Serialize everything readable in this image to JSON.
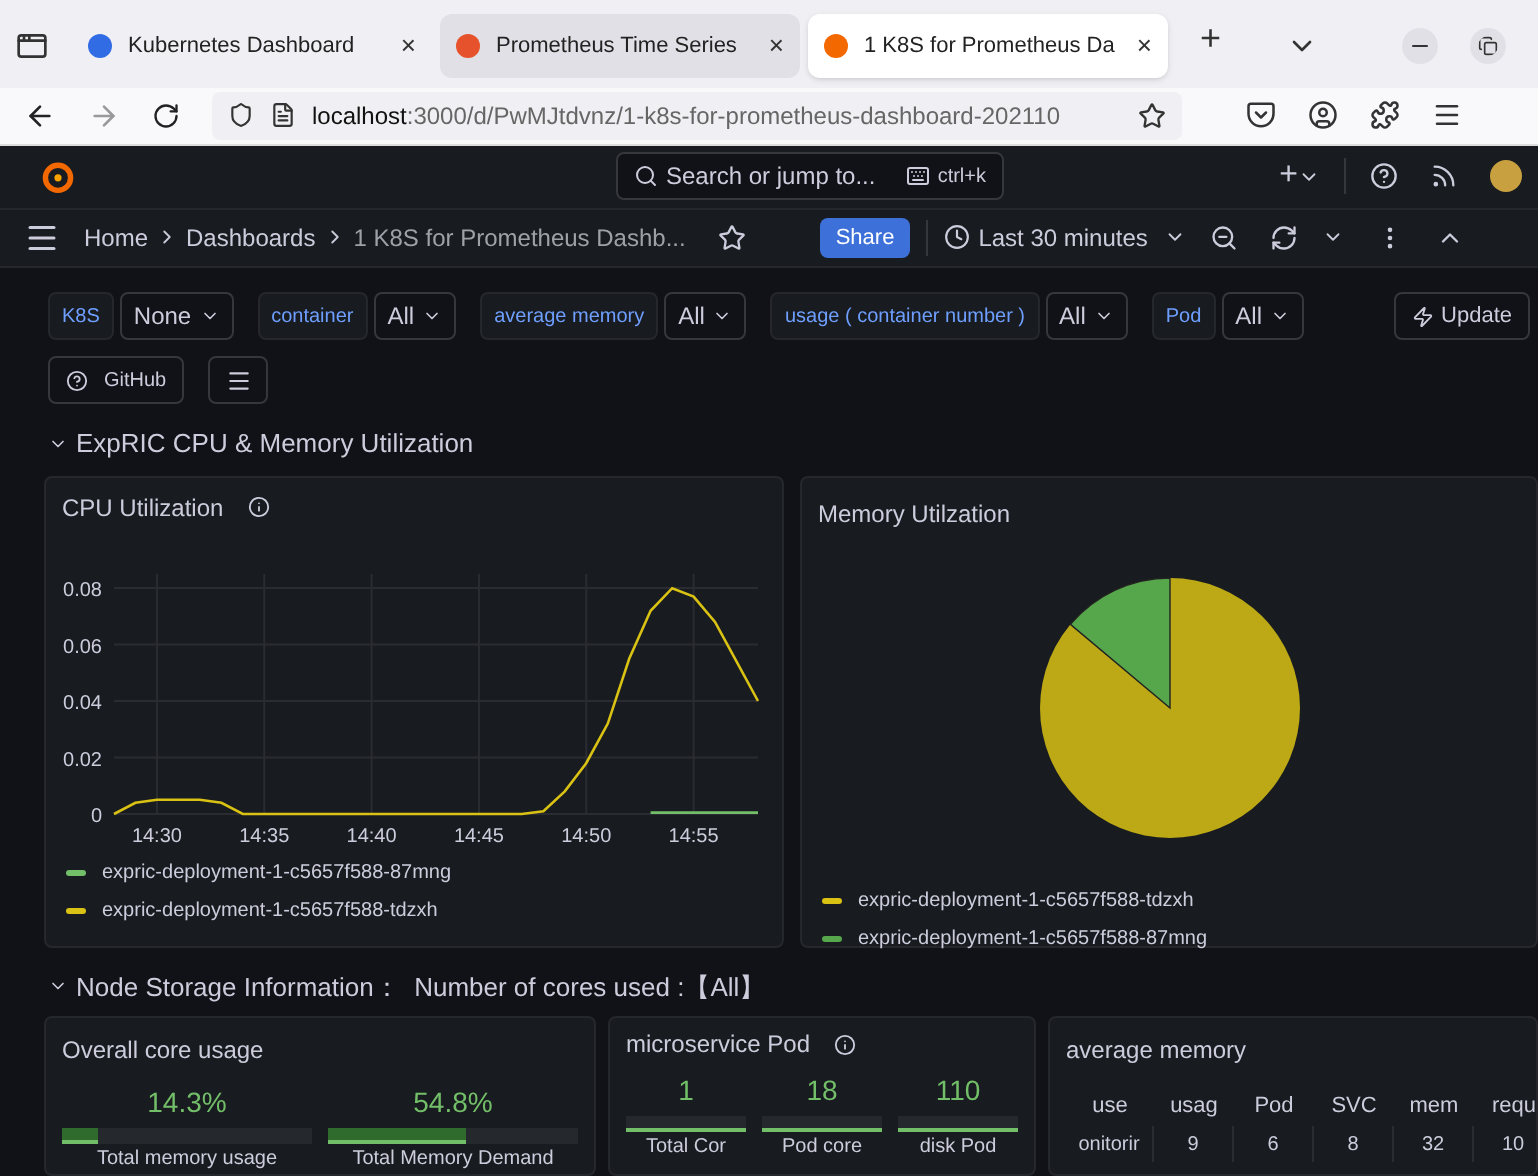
{
  "browser": {
    "tabs": [
      {
        "title": "Kubernetes Dashboard",
        "selected": false,
        "close": "×"
      },
      {
        "title": "Prometheus Time Series",
        "selected": false,
        "close": "×"
      },
      {
        "title": "1 K8S for Prometheus Da",
        "selected": true,
        "close": "×"
      }
    ],
    "new_tab": "+",
    "url_host": "localhost",
    "url_path": ":3000/d/PwMJtdvnz/1-k8s-for-prometheus-dashboard-202110"
  },
  "topbar": {
    "search_placeholder": "Search or jump to...",
    "shortcut": "ctrl+k",
    "add": "+"
  },
  "breadcrumbs": [
    "Home",
    "Dashboards",
    "1 K8S for Prometheus Dashb..."
  ],
  "toolbar": {
    "share": "Share",
    "time_range": "Last 30 minutes"
  },
  "variables": [
    {
      "label": "K8S",
      "value": "None"
    },
    {
      "label": "container",
      "value": "All"
    },
    {
      "label": "average memory",
      "value": "All"
    },
    {
      "label": "usage ( container number )",
      "value": "All"
    },
    {
      "label": "Pod",
      "value": "All"
    }
  ],
  "update": "Update",
  "github": "GitHub",
  "row1": {
    "title": "ExpRIC CPU & Memory Utilization",
    "expanded": true
  },
  "cpu_panel": {
    "title": "CPU Utilization",
    "chart_data": {
      "type": "line",
      "categories": [
        null,
        null,
        "14:30",
        null,
        null,
        null,
        null,
        "14:35",
        null,
        null,
        null,
        null,
        "14:40",
        null,
        null,
        null,
        null,
        "14:45",
        null,
        null,
        null,
        null,
        "14:50",
        null,
        null,
        null,
        null,
        "14:55",
        null,
        null,
        null
      ],
      "grid": true,
      "series": [
        {
          "name": "expric-deployment-1-c5657f588-87mng",
          "color": "#73bf69",
          "values": [
            null,
            null,
            null,
            null,
            null,
            null,
            null,
            null,
            null,
            null,
            null,
            null,
            null,
            null,
            null,
            null,
            null,
            null,
            null,
            null,
            null,
            null,
            null,
            null,
            null,
            0.0005,
            0.0005,
            0.0005,
            0.0005,
            0.0005,
            0.0005
          ]
        },
        {
          "name": "expric-deployment-1-c5657f588-tdzxh",
          "color": "#d9c214",
          "values": [
            0,
            0.004,
            0.005,
            0.005,
            0.005,
            0.004,
            0,
            0,
            0,
            0,
            0,
            0,
            0,
            0,
            0,
            0,
            0,
            0,
            0,
            0,
            0.001,
            0.008,
            0.018,
            0.032,
            0.055,
            0.072,
            0.08,
            0.077,
            0.068,
            0.054,
            0.04
          ]
        }
      ],
      "ylim": [
        0,
        0.085
      ],
      "yticks": [
        {
          "value": 0,
          "label": "0"
        },
        {
          "value": 0.02,
          "label": "0.02"
        },
        {
          "value": 0.04,
          "label": "0.04"
        },
        {
          "value": 0.06,
          "label": "0.06"
        },
        {
          "value": 0.08,
          "label": "0.08"
        }
      ]
    }
  },
  "memory_panel": {
    "title": "Memory Utilzation",
    "legend": [
      {
        "name": "expric-deployment-1-c5657f588-tdzxh",
        "color": "#d9c214"
      },
      {
        "name": "expric-deployment-1-c5657f588-87mng",
        "color": "#56a64b"
      }
    ]
  },
  "row2": {
    "title": "Node Storage Information：  Number of cores used :【All】",
    "expanded": true
  },
  "core_panel": {
    "title": "Overall core usage",
    "stats": [
      {
        "value": "14.3%",
        "label": "Total memory usage",
        "level": 0.143
      },
      {
        "value": "54.8%",
        "label": "Total Memory Demand",
        "level": 0.548
      }
    ]
  },
  "pod_panel": {
    "title": "microservice Pod",
    "stats": [
      {
        "value": "1",
        "label": "Total Cor"
      },
      {
        "value": "18",
        "label": "Pod core"
      },
      {
        "value": "110",
        "label": "disk Pod"
      }
    ]
  },
  "memory_table": {
    "title": "average memory",
    "columns": [
      "use",
      "usag",
      "Pod",
      "SVC",
      "mem",
      "requ"
    ],
    "rows": [
      [
        "onitorir",
        "9",
        "6",
        "8",
        "32",
        "10"
      ]
    ]
  }
}
